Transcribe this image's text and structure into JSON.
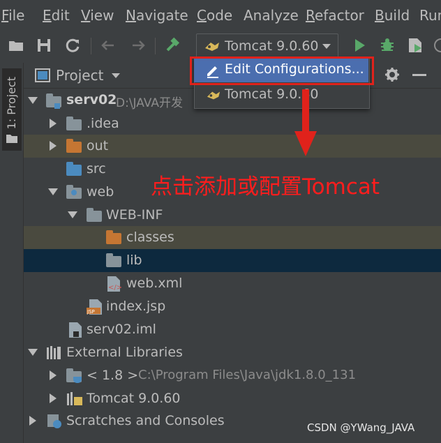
{
  "menu": {
    "items": [
      {
        "label": "File",
        "mnemonic": "F",
        "rest": "ile"
      },
      {
        "label": "Edit",
        "mnemonic": "E",
        "rest": "dit"
      },
      {
        "label": "View",
        "mnemonic": "V",
        "rest": "iew"
      },
      {
        "label": "Navigate",
        "mnemonic": "N",
        "rest": "avigate"
      },
      {
        "label": "Code",
        "mnemonic": "C",
        "rest": "ode"
      },
      {
        "label": "Analyze",
        "mnemonic": "",
        "rest": "Analyze"
      },
      {
        "label": "Refactor",
        "mnemonic": "R",
        "rest": "efactor"
      },
      {
        "label": "Build",
        "mnemonic": "B",
        "rest": "uild"
      },
      {
        "label": "Run",
        "mnemonic": "",
        "rest": "Run"
      }
    ]
  },
  "toolbar": {
    "run_config_label": "Tomcat 9.0.60"
  },
  "popup": {
    "edit_configurations": "Edit Configurations...",
    "tomcat_item": "Tomcat 9.0.60"
  },
  "side": {
    "tab_label": "1: Project"
  },
  "panel": {
    "title": "Project"
  },
  "tree": {
    "root_name": "serv02",
    "root_path": "D:\\JAVA开发",
    "idea": ".idea",
    "out": "out",
    "src": "src",
    "web": "web",
    "webinf": "WEB-INF",
    "classes": "classes",
    "lib": "lib",
    "webxml": "web.xml",
    "indexjsp": "index.jsp",
    "iml": "serv02.iml",
    "external": "External Libraries",
    "jdk_name": "< 1.8 >",
    "jdk_path": "C:\\Program Files\\Java\\jdk1.8.0_131",
    "tomcat_lib": "Tomcat 9.0.60",
    "scratches": "Scratches and Consoles"
  },
  "annotation": "点击添加或配置Tomcat",
  "watermark": "CSDN @YWang_JAVA",
  "colors": {
    "background": "#3c3f41",
    "selection_active": "#0d293e",
    "selection_inactive": "#4a4a3f",
    "popup_highlight": "#4b6eaf",
    "annotation_red": "#ff1d1d",
    "folder_blue": "#87939a",
    "folder_orange": "#c57633",
    "run_green": "#59a869"
  }
}
